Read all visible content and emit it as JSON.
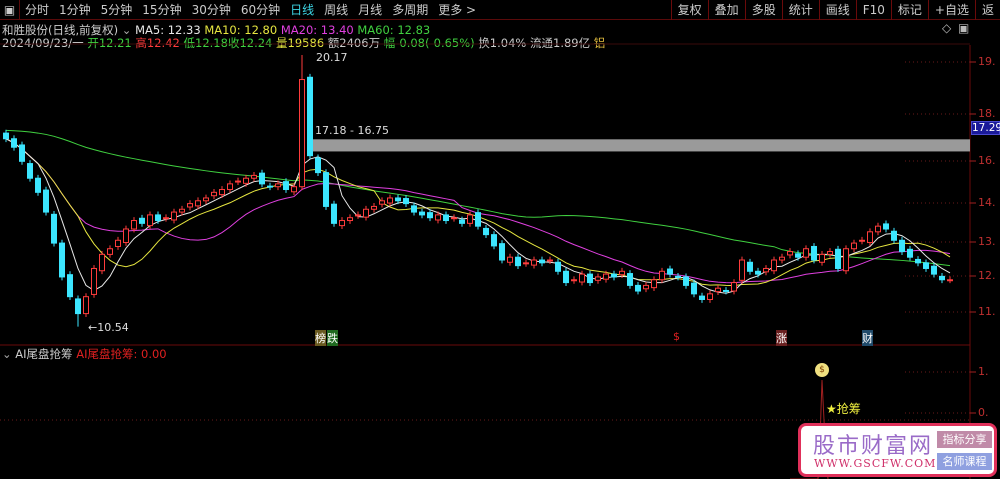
{
  "toolbar": {
    "periods": [
      "分时",
      "1分钟",
      "5分钟",
      "15分钟",
      "30分钟",
      "60分钟",
      "日线",
      "周线",
      "月线",
      "多周期",
      "更多 >"
    ],
    "active": "日线",
    "tools": [
      "复权",
      "叠加",
      "多股",
      "统计",
      "画线",
      "F10",
      "标记",
      "+自选",
      "返"
    ]
  },
  "header": {
    "title": "和胜股份(日线,前复权)",
    "ma5": "MA5: 12.33",
    "ma10": "MA10: 12.80",
    "ma20": "MA20: 13.40",
    "ma60": "MA60: 12.83",
    "date": "2024/09/23/一",
    "open_l": "开",
    "open": "12.21",
    "high_l": "高",
    "high": "12.42",
    "low_l": "低",
    "low": "12.18",
    "close_l": "收",
    "close": "12.24",
    "vol_l": "量",
    "vol": "19586",
    "amt": "额2406万",
    "chg_l": "幅",
    "chg": "-0.08(-0.65%)",
    "turnover": "换1.04%",
    "float": "流通1.89亿",
    "tag": "铝"
  },
  "colors": {
    "up": "#ff3c3c",
    "down": "#3ce6ff",
    "ma5": "#e8e8e8",
    "ma10": "#e6e640",
    "ma20": "#e040e0",
    "ma60": "#40d040"
  },
  "price_axis": [
    "19.",
    "18.",
    "17.29",
    "16.",
    "14.",
    "13.",
    "12.",
    "11."
  ],
  "annotations": {
    "high": "20.17",
    "low": "←10.54",
    "gap": "17.18 - 16.75"
  },
  "markers": [
    "榜",
    "跌",
    "$",
    "涨",
    "财"
  ],
  "indicator": {
    "name": "AI尾盘抢筹",
    "value_label": "AI尾盘抢筹: 0.00",
    "signal": "★抢筹",
    "axis": [
      "1.",
      "0.",
      "0."
    ]
  },
  "watermark": {
    "title": "股市财富网",
    "url": "WWW.GSCFW.COM",
    "tag1": "指标分享",
    "tag2": "名师课程"
  },
  "chart_data": {
    "type": "candlestick",
    "closes": [
      17.2,
      16.9,
      16.4,
      15.8,
      15.3,
      14.6,
      13.5,
      12.3,
      11.6,
      11.0,
      11.6,
      12.6,
      13.1,
      13.3,
      13.6,
      14.0,
      14.3,
      14.2,
      14.5,
      14.3,
      14.4,
      14.6,
      14.7,
      14.9,
      15.0,
      15.1,
      15.3,
      15.4,
      15.6,
      15.7,
      15.8,
      15.9,
      15.6,
      15.5,
      15.6,
      15.4,
      15.5,
      19.3,
      16.6,
      16.0,
      14.8,
      14.2,
      14.3,
      14.4,
      14.5,
      14.7,
      14.8,
      15.0,
      15.1,
      15.0,
      14.9,
      14.6,
      14.5,
      14.4,
      14.5,
      14.3,
      14.4,
      14.2,
      14.5,
      14.1,
      13.8,
      13.4,
      12.9,
      13.0,
      12.7,
      12.8,
      12.9,
      12.8,
      12.9,
      12.5,
      12.1,
      12.2,
      12.4,
      12.1,
      12.3,
      12.4,
      12.3,
      12.5,
      12.0,
      11.8,
      12.0,
      12.2,
      12.5,
      12.4,
      12.3,
      12.0,
      11.7,
      11.5,
      11.7,
      11.9,
      11.8,
      12.1,
      12.9,
      12.5,
      12.4,
      12.6,
      12.9,
      13.0,
      13.2,
      13.0,
      13.3,
      12.9,
      13.1,
      13.2,
      12.6,
      13.3,
      13.5,
      13.6,
      13.9,
      14.1,
      14.0,
      13.6,
      13.2,
      13.0,
      12.8,
      12.6,
      12.4,
      12.2,
      12.2
    ],
    "ma60_start": 17.5
  }
}
